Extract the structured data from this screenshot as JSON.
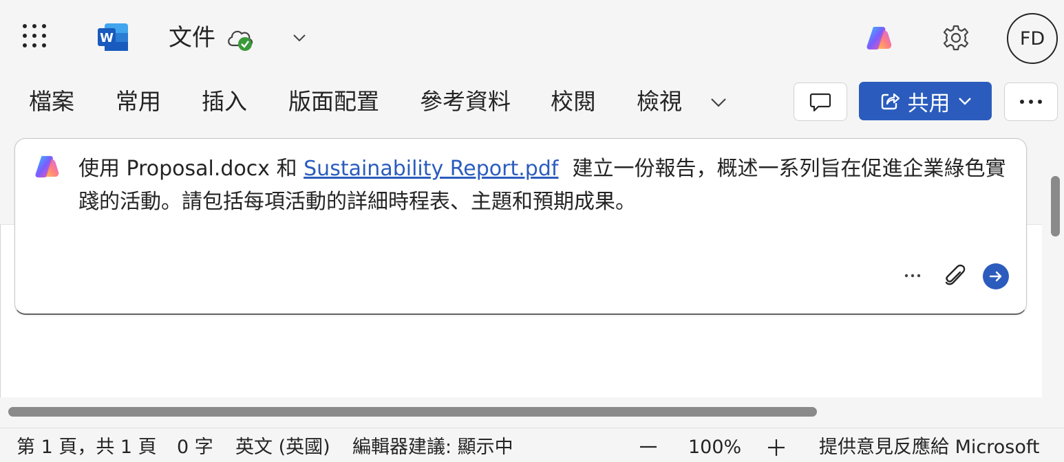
{
  "titlebar": {
    "doc_title": "文件",
    "avatar_initials": "FD",
    "icons": [
      "app-launcher-icon",
      "word-logo",
      "cloud-saved-icon",
      "chevron-down-icon",
      "copilot-icon",
      "gear-icon"
    ]
  },
  "ribbon": {
    "tabs": [
      "檔案",
      "常用",
      "插入",
      "版面配置",
      "參考資料",
      "校閱",
      "檢視"
    ],
    "share_label": "共用",
    "accent_color": "#2b5cbd"
  },
  "prompt": {
    "text_before": "使用 Proposal.docx 和 ",
    "file_link": "Sustainability Report.pdf",
    "text_after": "建立一份報告，概述一系列旨在促進企業綠色實踐的活動。請包括每項活動的詳細時程表、主題和預期成果。"
  },
  "status": {
    "page": "第 1 頁，共 1 頁",
    "words": "0 字",
    "language": "英文 (英國)",
    "editor": "編輯器建議: 顯示中",
    "zoom": "100%",
    "feedback": "提供意見反應給 Microsoft"
  }
}
